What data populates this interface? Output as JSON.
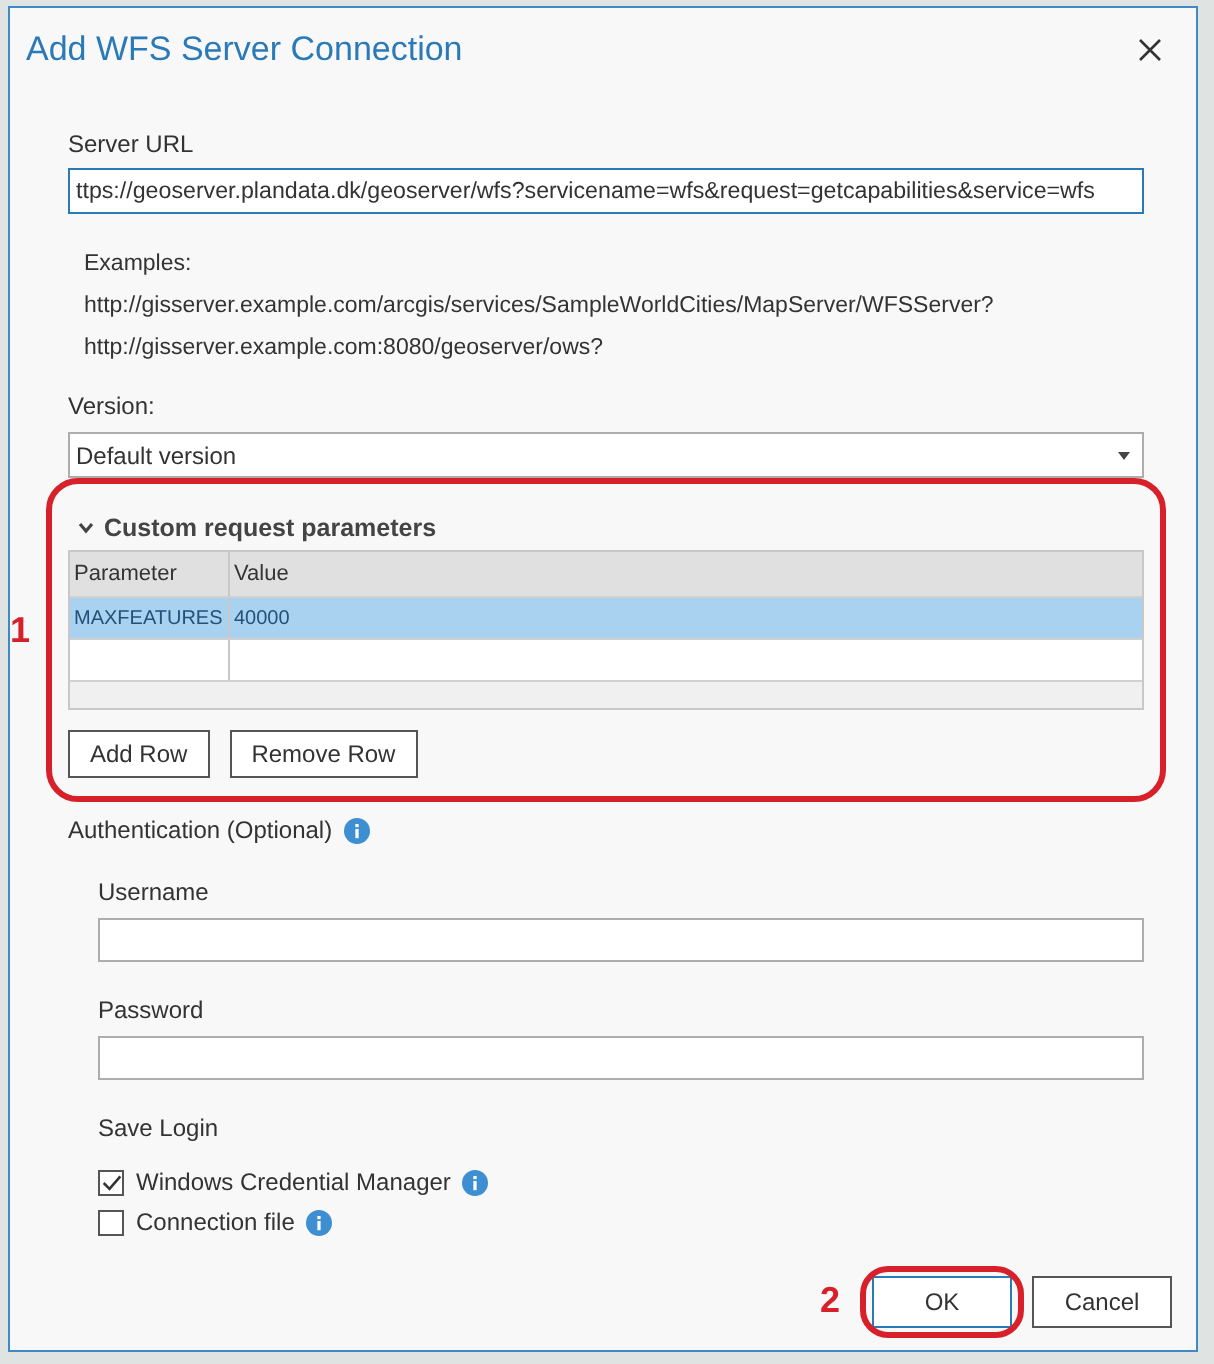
{
  "window": {
    "title": "Add WFS Server Connection"
  },
  "server_url": {
    "label": "Server URL",
    "value": "ttps://geoserver.plandata.dk/geoserver/wfs?servicename=wfs&request=getcapabilities&service=wfs"
  },
  "examples": {
    "label": "Examples:",
    "urls": [
      "http://gisserver.example.com/arcgis/services/SampleWorldCities/MapServer/WFSServer?",
      "http://gisserver.example.com:8080/geoserver/ows?"
    ]
  },
  "version": {
    "label": "Version:",
    "value": "Default version"
  },
  "custom_parameters": {
    "title": "Custom request parameters",
    "expanded": true,
    "columns": [
      "Parameter",
      "Value"
    ],
    "rows": [
      {
        "cells": [
          "MAXFEATURES",
          "40000"
        ],
        "selected": true
      }
    ],
    "buttons": [
      "Add Row",
      "Remove Row"
    ]
  },
  "authentication": {
    "label": "Authentication (Optional)",
    "fields": [
      {
        "label": "Username"
      },
      {
        "label": "Password"
      }
    ],
    "save_login": {
      "label": "Save Login",
      "options": [
        {
          "label": "Windows Credential Manager",
          "checked": true
        },
        {
          "label": "Connection file",
          "checked": false
        }
      ]
    }
  },
  "buttons": [
    {
      "label": "OK",
      "focused": true
    },
    {
      "label": "Cancel",
      "focused": false
    }
  ],
  "annotations": [
    {
      "label": "1"
    },
    {
      "label": "2"
    }
  ]
}
